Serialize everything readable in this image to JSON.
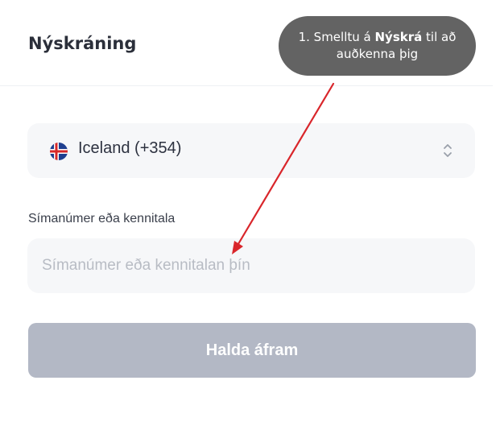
{
  "header": {
    "title": "Nýskráning"
  },
  "country_select": {
    "value": "Iceland (+354)",
    "flag_icon": "iceland-flag-icon",
    "chevron_icon": "chevron-up-down-icon"
  },
  "phone_field": {
    "label": "Símanúmer eða kennitala",
    "placeholder": "Símanúmer eða kennitalan þín",
    "value": ""
  },
  "continue_button": {
    "label": "Halda áfram"
  },
  "tooltip": {
    "prefix": "1. Smelltu á ",
    "emphasis": "Nýskrá",
    "suffix_line1": " til að",
    "line2": "auðkenna þig"
  },
  "colors": {
    "button_disabled": "#b3b8c5",
    "field_background": "#f6f7f9",
    "tooltip_background": "#636363",
    "annotation_arrow": "#d9262b",
    "flag_blue": "#1f3f8f",
    "flag_red": "#d72828"
  }
}
